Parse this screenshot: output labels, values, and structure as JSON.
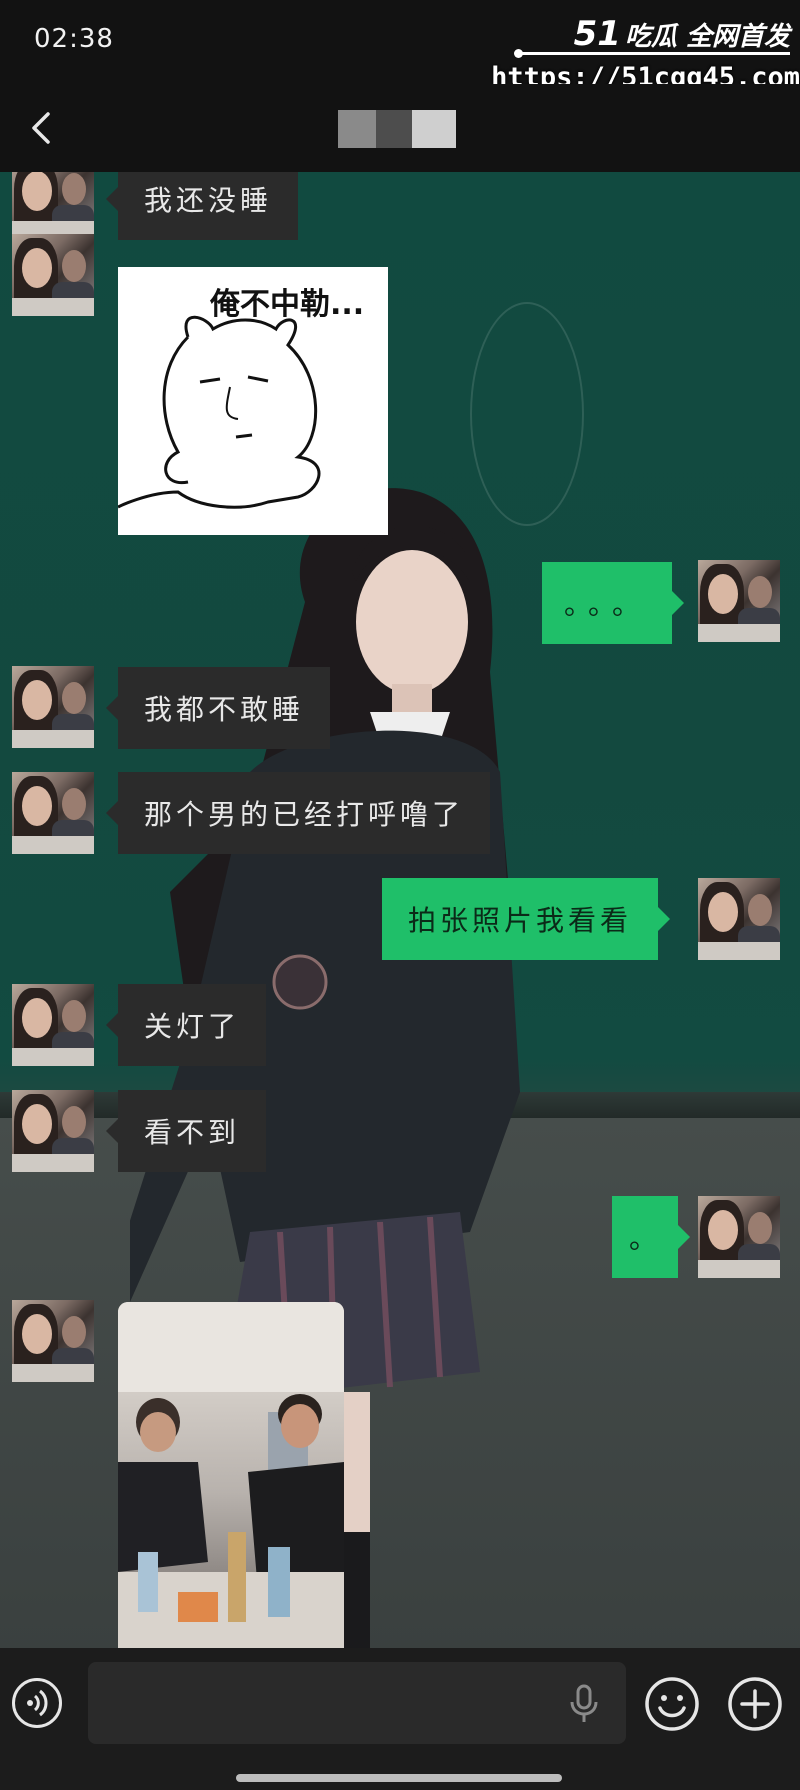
{
  "status_bar": {
    "time": "02:38"
  },
  "watermark": {
    "brand_num": "51",
    "brand_text": "吃瓜 全网首发",
    "url": "https://51cgg45.com"
  },
  "nav": {
    "back_icon": "chevron-left-icon",
    "contact_name_redacted": true
  },
  "colors": {
    "outgoing_bubble": "#1fbf69",
    "incoming_bubble": "#2b2b2b",
    "chat_bg": "#114a40"
  },
  "messages": [
    {
      "side": "in",
      "type": "text",
      "text": "我还没睡"
    },
    {
      "side": "in",
      "type": "sticker",
      "text": "俺不中勒..."
    },
    {
      "side": "out",
      "type": "text",
      "text": "。。。"
    },
    {
      "side": "in",
      "type": "text",
      "text": "我都不敢睡"
    },
    {
      "side": "in",
      "type": "text",
      "text": "那个男的已经打呼噜了"
    },
    {
      "side": "out",
      "type": "text",
      "text": "拍张照片我看看"
    },
    {
      "side": "in",
      "type": "text",
      "text": "关灯了"
    },
    {
      "side": "in",
      "type": "text",
      "text": "看不到"
    },
    {
      "side": "out",
      "type": "text",
      "text": "。"
    },
    {
      "side": "in",
      "type": "image"
    }
  ],
  "input_bar": {
    "icons": [
      "voice-icon",
      "microphone-icon",
      "emoji-icon",
      "plus-icon"
    ],
    "placeholder": ""
  }
}
